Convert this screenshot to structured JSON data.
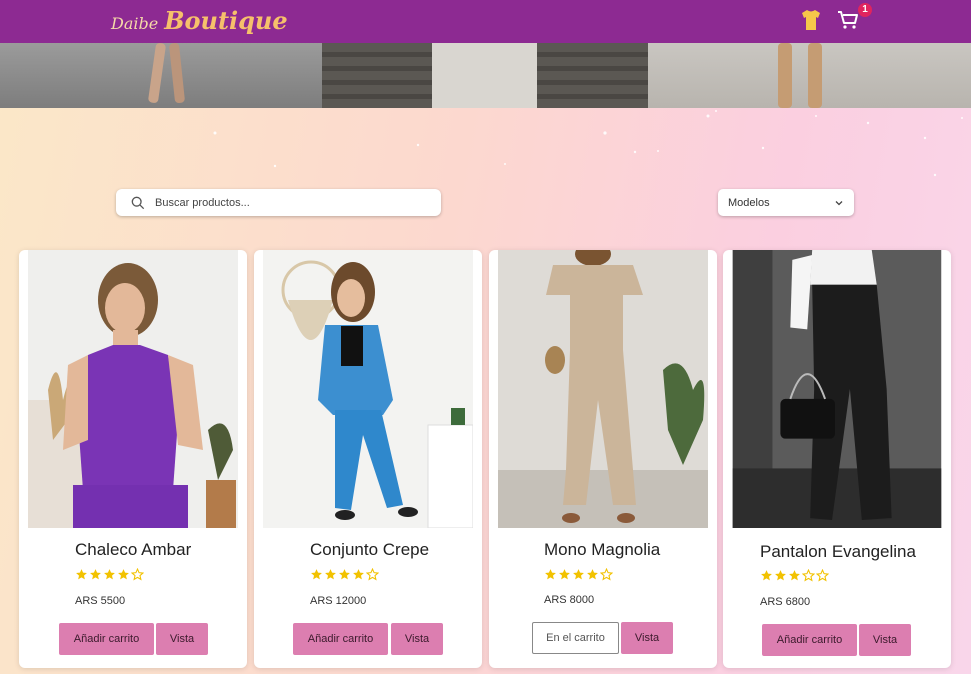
{
  "navbar": {
    "brand_small": "Daibe",
    "brand_big": "Boutique",
    "cart_count": "1",
    "shirt_icon": "tshirt-icon",
    "cart_icon": "cart-icon",
    "bg_color": "#8d2a92"
  },
  "search": {
    "placeholder": "Buscar productos...",
    "value": ""
  },
  "filter": {
    "selected": "Modelos"
  },
  "products": [
    {
      "name": "Chaleco Ambar",
      "rating": 4,
      "price": "ARS 5500",
      "btn_primary": "Añadir carrito",
      "btn_view": "Vista",
      "in_cart": false
    },
    {
      "name": "Conjunto Crepe",
      "rating": 4,
      "price": "ARS 12000",
      "btn_primary": "Añadir carrito",
      "btn_view": "Vista",
      "in_cart": false
    },
    {
      "name": "Mono Magnolia",
      "rating": 4,
      "price": "ARS 8000",
      "btn_primary": "En el carrito",
      "btn_view": "Vista",
      "in_cart": true
    },
    {
      "name": "Pantalon Evangelina",
      "rating": 3,
      "price": "ARS 6800",
      "btn_primary": "Añadir carrito",
      "btn_view": "Vista",
      "in_cart": false
    }
  ],
  "colors": {
    "accent": "#dc7eb0",
    "star": "#f2c200"
  }
}
